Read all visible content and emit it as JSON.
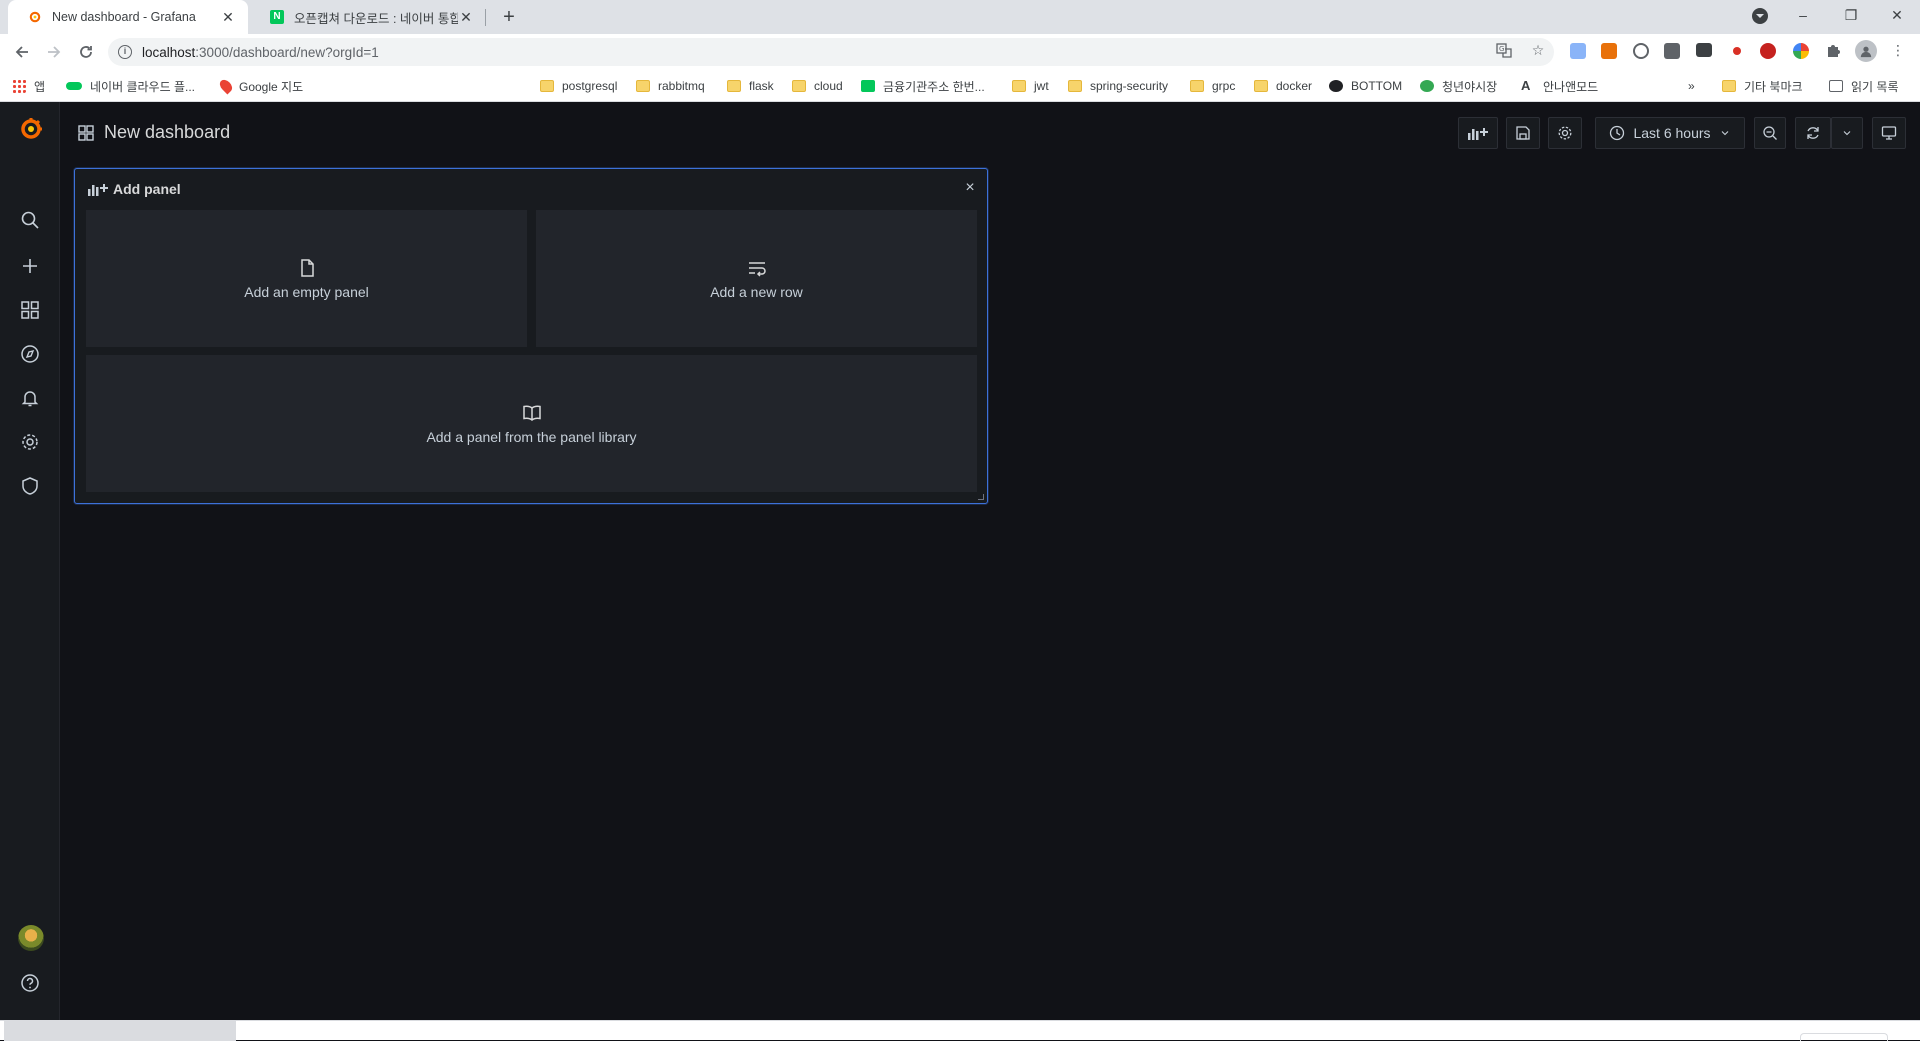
{
  "browser": {
    "tabs": [
      {
        "title": "New dashboard - Grafana",
        "active": true
      },
      {
        "title": "오픈캡쳐 다운로드 : 네이버 통합",
        "active": false
      }
    ],
    "new_tab": "+",
    "window_controls": {
      "minimize": "–",
      "restore": "❐",
      "close": "✕"
    },
    "url_host": "localhost",
    "url_path": ":3000/dashboard/new?orgId=1",
    "bookmarks": [
      {
        "label": "앱",
        "icon": "apps-grid-icon"
      },
      {
        "label": "네이버 클라우드 플...",
        "icon": "naver-cloud-icon"
      },
      {
        "label": "Google 지도",
        "icon": "maps-pin-icon"
      },
      {
        "label": "postgresql",
        "icon": "folder-icon"
      },
      {
        "label": "rabbitmq",
        "icon": "folder-icon"
      },
      {
        "label": "flask",
        "icon": "folder-icon"
      },
      {
        "label": "cloud",
        "icon": "folder-icon"
      },
      {
        "label": "금융기관주소 한번...",
        "icon": "site-icon"
      },
      {
        "label": "jwt",
        "icon": "folder-icon"
      },
      {
        "label": "spring-security",
        "icon": "folder-icon"
      },
      {
        "label": "grpc",
        "icon": "folder-icon"
      },
      {
        "label": "docker",
        "icon": "folder-icon"
      },
      {
        "label": "BOTTOM",
        "icon": "site-icon"
      },
      {
        "label": "청년야시장",
        "icon": "site-icon"
      },
      {
        "label": "안나앤모드",
        "icon": "site-icon"
      }
    ],
    "bookmarks_overflow": "»",
    "other_bookmarks": "기타 북마크",
    "reading_list": "읽기 목록"
  },
  "grafana": {
    "dashboard_title": "New dashboard",
    "time_range": "Last 6 hours",
    "add_panel": {
      "title": "Add panel",
      "close": "×",
      "options": {
        "empty_panel": "Add an empty panel",
        "new_row": "Add a new row",
        "library_panel": "Add a panel from the panel library"
      }
    },
    "colors": {
      "background": "#111217",
      "panel": "#181b1f",
      "option": "#22252b",
      "accent_border": "#3d71d9",
      "logo_orange": "#f46800"
    }
  }
}
